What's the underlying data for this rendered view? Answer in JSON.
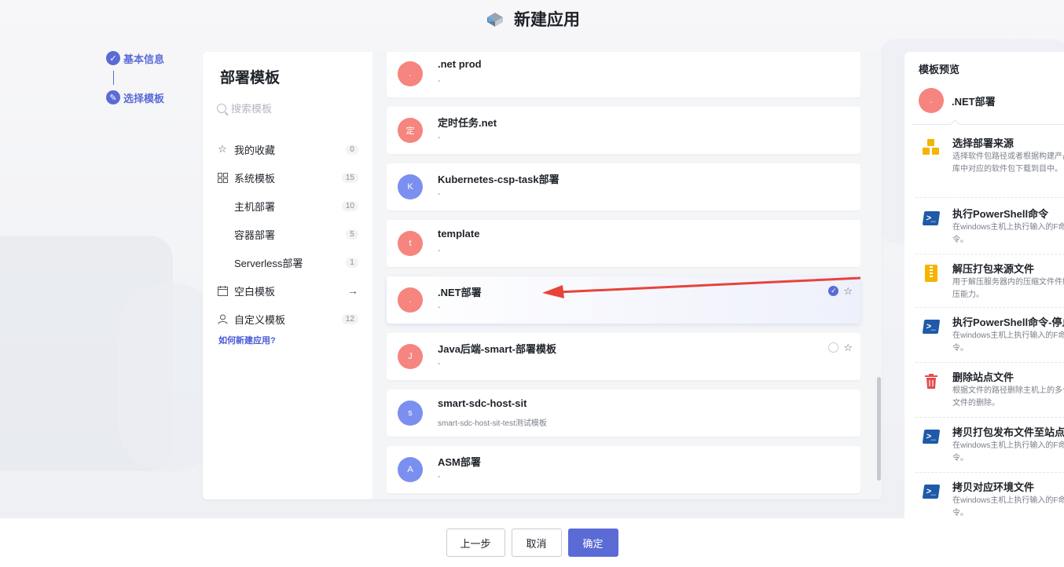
{
  "header": {
    "title": "新建应用"
  },
  "steps": [
    {
      "label": "基本信息",
      "state": "done"
    },
    {
      "label": "选择模板",
      "state": "active"
    }
  ],
  "left_panel": {
    "title": "部署模板",
    "search_placeholder": "搜索模板",
    "menu": [
      {
        "label": "我的收藏",
        "count": "0"
      },
      {
        "label": "系统模板",
        "count": "15"
      },
      {
        "label": "主机部署",
        "count": "10"
      },
      {
        "label": "容器部署",
        "count": "5"
      },
      {
        "label": "Serverless部署",
        "count": "1"
      },
      {
        "label": "空白模板"
      },
      {
        "label": "自定义模板",
        "count": "12"
      }
    ],
    "help_link": "如何新建应用?"
  },
  "templates": [
    {
      "avatar": ".",
      "name": ".net prod",
      "desc": "-",
      "color": "#f5857e"
    },
    {
      "avatar": "定",
      "name": "定时任务.net",
      "desc": "-",
      "color": "#f5857e"
    },
    {
      "avatar": "K",
      "name": "Kubernetes-csp-task部署",
      "desc": "-",
      "color": "#7b8ff0"
    },
    {
      "avatar": "t",
      "name": "template",
      "desc": "-",
      "color": "#f5857e"
    },
    {
      "avatar": ".",
      "name": ".NET部署",
      "desc": "-",
      "color": "#f5857e"
    },
    {
      "avatar": "J",
      "name": "Java后端-smart-部署模板",
      "desc": "-",
      "color": "#f5857e"
    },
    {
      "avatar": "s",
      "name": "smart-sdc-host-sit",
      "desc": "smart-sdc-host-sit-test测试模板",
      "color": "#7b8ff0"
    },
    {
      "avatar": "A",
      "name": "ASM部署",
      "desc": "-",
      "color": "#7b8ff0"
    }
  ],
  "preview": {
    "title": "模板预览",
    "avatar": ".",
    "name": ".NET部署",
    "steps": [
      {
        "icon": "boxes-icon",
        "title": "选择部署来源",
        "desc": "选择软件包路径或者根据构建产品库中对应的软件包下载到目中。"
      },
      {
        "icon": "powershell-icon",
        "title": "执行PowerShell命令",
        "desc": "在windows主机上执行输入的F命令。"
      },
      {
        "icon": "zip-icon",
        "title": "解压打包来源文件",
        "desc": "用于解压服务器内的压缩文件件解压能力。"
      },
      {
        "icon": "powershell-icon",
        "title": "执行PowerShell命令-停止",
        "desc": "在windows主机上执行输入的F命令。"
      },
      {
        "icon": "trash-icon",
        "title": "删除站点文件",
        "desc": "根据文件的路径删除主机上的多个文件的删除。"
      },
      {
        "icon": "powershell-icon",
        "title": "拷贝打包发布文件至站点",
        "desc": "在windows主机上执行输入的F命令。"
      },
      {
        "icon": "powershell-icon",
        "title": "拷贝对应环境文件",
        "desc": "在windows主机上执行输入的F命令。"
      }
    ]
  },
  "footer": {
    "prev": "上一步",
    "cancel": "取消",
    "confirm": "确定"
  },
  "colors": {
    "primary": "#5b6bd6",
    "avatar_red": "#f5857e",
    "avatar_blue": "#7b8ff0",
    "arrow": "#e8433a"
  }
}
